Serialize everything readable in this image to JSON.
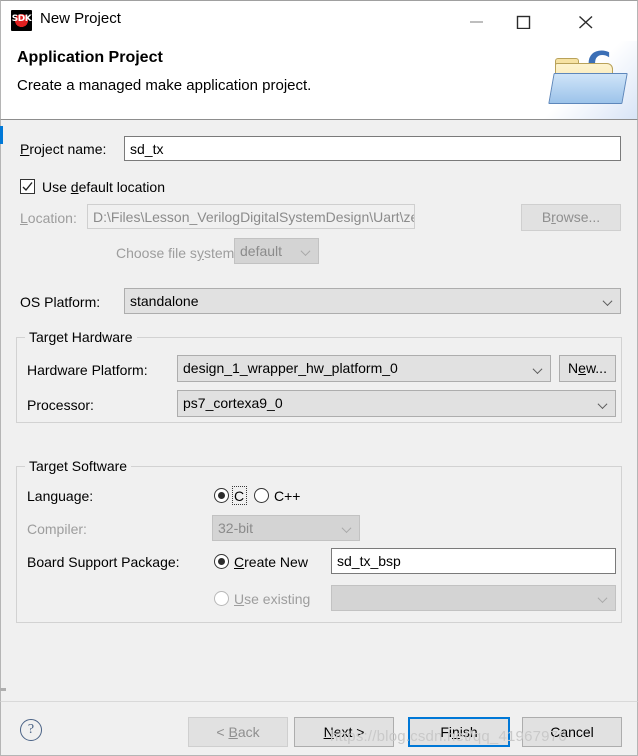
{
  "window": {
    "title": "New Project",
    "app_icon": "sdk-icon",
    "icon_label": "SDK",
    "controls": {
      "minimize": "minimize-icon",
      "maximize": "maximize-icon",
      "close": "close-icon"
    }
  },
  "header": {
    "title": "Application Project",
    "subtitle": "Create a managed make application project.",
    "banner_icon": "c-folder-icon",
    "banner_letter": "C"
  },
  "form": {
    "project_name": {
      "label_pre": "P",
      "label_post": "roject name:",
      "value": "sd_tx"
    },
    "use_default_location": {
      "label_pre": "Use ",
      "label_mn": "d",
      "label_post": "efault location",
      "checked": true
    },
    "location": {
      "label_mn": "L",
      "label_post": "ocation:",
      "value": "D:\\Files\\Lesson_VerilogDigitalSystemDesign\\Uart\\zedboa",
      "enabled": false
    },
    "browse_button": {
      "label_pre": "B",
      "label_mn": "r",
      "label_post": "owse...",
      "enabled": false
    },
    "choose_file_system": {
      "label_pre": "Choose file s",
      "label_mn": "y",
      "label_post": "stem:",
      "value": "default",
      "enabled": false
    },
    "os_platform": {
      "label": "OS Platform:",
      "value": "standalone"
    }
  },
  "target_hardware": {
    "group_title": "Target Hardware",
    "hardware_platform": {
      "label": "Hardware Platform:",
      "value": "design_1_wrapper_hw_platform_0"
    },
    "new_button": {
      "label_pre": "N",
      "label_mn": "e",
      "label_post": "w...",
      "enabled": true
    },
    "processor": {
      "label": "Processor:",
      "value": "ps7_cortexa9_0"
    }
  },
  "target_software": {
    "group_title": "Target Software",
    "language": {
      "label": "Language:",
      "options": [
        "C",
        "C++"
      ],
      "selected": "C"
    },
    "compiler": {
      "label": "Compiler:",
      "value": "32-bit",
      "enabled": false
    },
    "bsp": {
      "label": "Board Support Package:",
      "create_new": {
        "label_mn": "C",
        "label_post": "reate New",
        "selected": true,
        "value": "sd_tx_bsp"
      },
      "use_existing": {
        "label_mn": "U",
        "label_post": "se existing",
        "selected": false,
        "value": "",
        "enabled": false
      }
    }
  },
  "footer": {
    "help_icon": "help-icon",
    "help_glyph": "?",
    "buttons": {
      "back": {
        "label_pre": "< ",
        "label_mn": "B",
        "label_post": "ack",
        "enabled": false
      },
      "next": {
        "label_pre": "",
        "label_mn": "N",
        "label_post": "ext >",
        "enabled": true
      },
      "finish": {
        "label_pre": "Fi",
        "label_mn": "n",
        "label_post": "ish",
        "enabled": true,
        "focused": true
      },
      "cancel": {
        "label": "Cancel",
        "enabled": true
      }
    }
  },
  "watermark": {
    "text": "https://blog.csdn.net/qq_41967976"
  },
  "colors": {
    "accent": "#0078d7",
    "dialog_bg": "#f0f0f0",
    "disabled_text": "#8b8b8b"
  }
}
